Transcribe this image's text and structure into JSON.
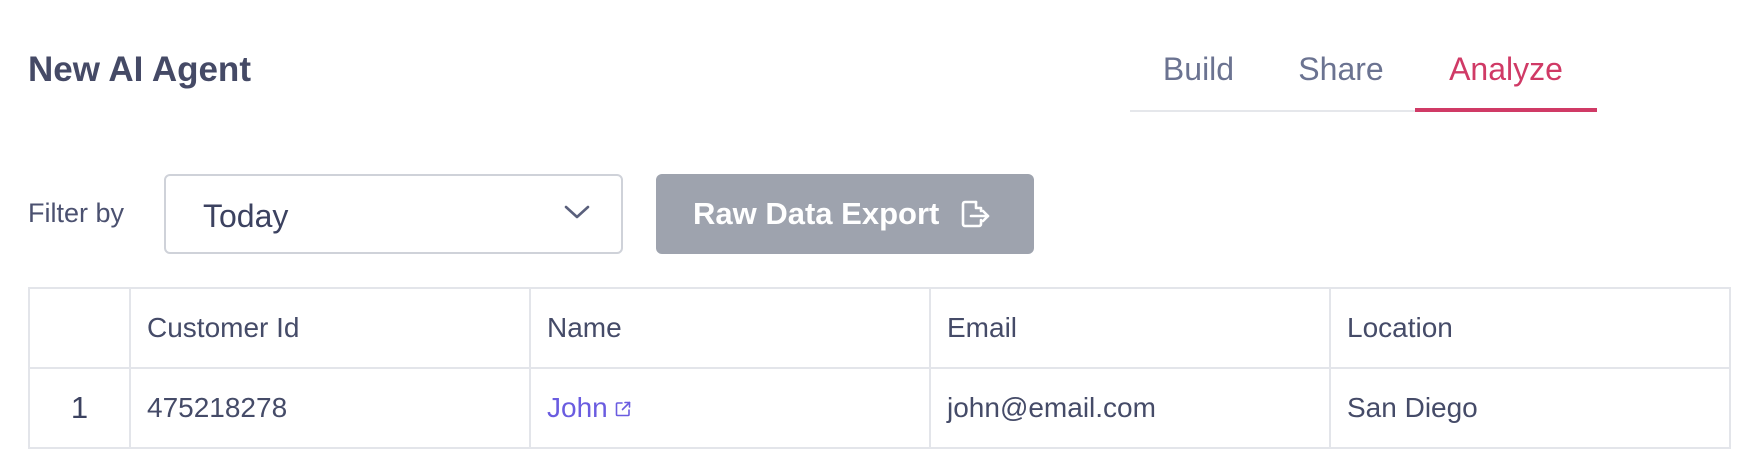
{
  "page": {
    "title": "New AI Agent"
  },
  "tabs": [
    {
      "label": "Build",
      "active": false
    },
    {
      "label": "Share",
      "active": false
    },
    {
      "label": "Analyze",
      "active": true
    }
  ],
  "filter": {
    "label": "Filter by",
    "selected": "Today",
    "icon": "chevron-down-icon"
  },
  "export": {
    "label": "Raw Data Export",
    "icon": "export-icon",
    "disabled": true
  },
  "table": {
    "columns": [
      "",
      "Customer Id",
      "Name",
      "Email",
      "Location"
    ],
    "rows": [
      {
        "index": "1",
        "customer_id": "475218278",
        "name": "John",
        "email": "john@email.com",
        "location": "San Diego"
      }
    ]
  },
  "colors": {
    "accent": "#d03a66",
    "link": "#6a5ce0",
    "button_disabled": "#9ea3ae",
    "text": "#454a66"
  }
}
